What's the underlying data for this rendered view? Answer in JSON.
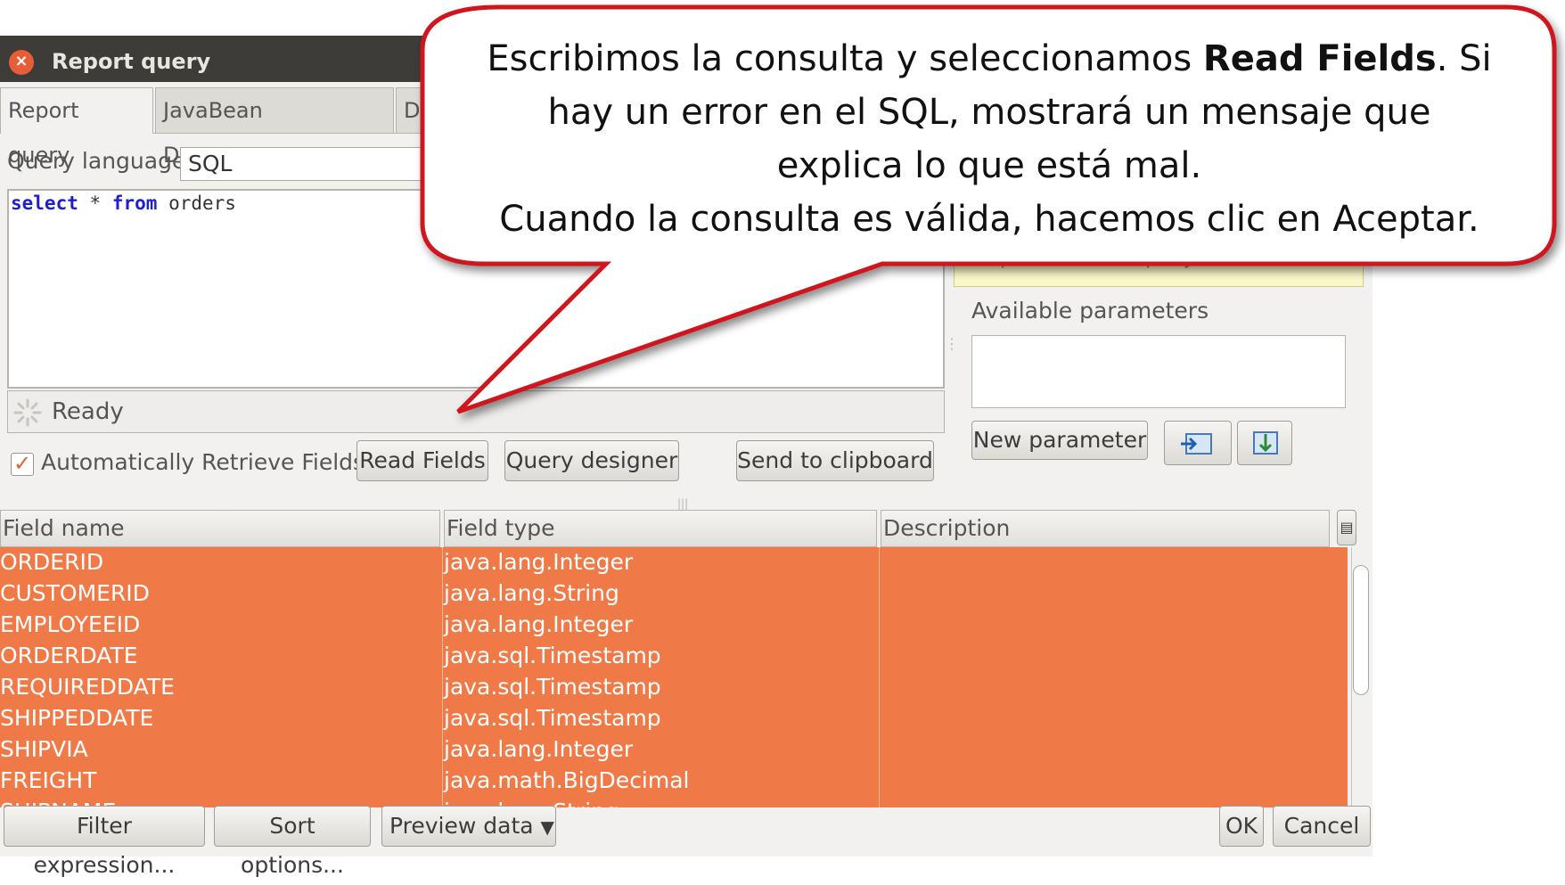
{
  "window": {
    "title": "Report query",
    "close_symbol": "×"
  },
  "tabs": [
    {
      "label": "Report query"
    },
    {
      "label": "JavaBean Datasource"
    },
    {
      "label": "D"
    }
  ],
  "query": {
    "language_label": "Query language",
    "language_value": "SQL",
    "sql_keyword_1": "select",
    "sql_star": "*",
    "sql_keyword_2": "from",
    "sql_table": "orders"
  },
  "status": {
    "text": "Ready"
  },
  "toolbar": {
    "auto_retrieve_label": "Automatically Retrieve Fields",
    "auto_retrieve_checked": true,
    "read_fields": "Read Fields",
    "query_designer": "Query designer",
    "send_to_clipboard": "Send to clipboard"
  },
  "parameters": {
    "hint_text": "the parameter as query chunk.",
    "available_label": "Available parameters",
    "new_parameter": "New parameter"
  },
  "table": {
    "headers": [
      "Field name",
      "Field type",
      "Description"
    ],
    "rows": [
      {
        "name": "ORDERID",
        "type": "java.lang.Integer"
      },
      {
        "name": "CUSTOMERID",
        "type": "java.lang.String"
      },
      {
        "name": "EMPLOYEEID",
        "type": "java.lang.Integer"
      },
      {
        "name": "ORDERDATE",
        "type": "java.sql.Timestamp"
      },
      {
        "name": "REQUIREDDATE",
        "type": "java.sql.Timestamp"
      },
      {
        "name": "SHIPPEDDATE",
        "type": "java.sql.Timestamp"
      },
      {
        "name": "SHIPVIA",
        "type": "java.lang.Integer"
      },
      {
        "name": "FREIGHT",
        "type": "java.math.BigDecimal"
      },
      {
        "name": "SHIPNAME",
        "type": "java.lang.String"
      }
    ]
  },
  "bottom": {
    "filter_expression": "Filter expression...",
    "sort_options": "Sort options...",
    "preview_data": "Preview data",
    "ok": "OK",
    "cancel": "Cancel"
  },
  "callout": {
    "line1_before": "Escribimos la consulta y seleccionamos ",
    "line1_bold": "Read Fields",
    "line1_after": ". Si",
    "line2": "hay un error en el SQL, mostrará un mensaje que",
    "line3": "explica lo que está mal.",
    "line4": "Cuando la consulta es válida, hacemos clic en Aceptar."
  },
  "colors": {
    "row_highlight": "#ef7a48",
    "callout_border": "#d0121b",
    "titlebar": "#3d3c38"
  }
}
